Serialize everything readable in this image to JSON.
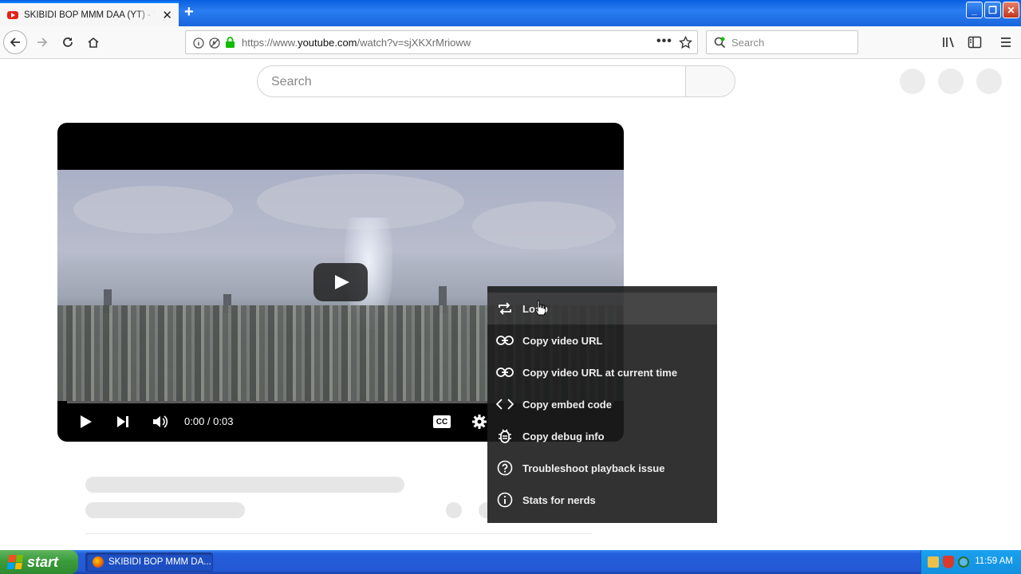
{
  "browser": {
    "tab_title": "SKIBIDI BOP MMM DAA (YT) - YouTube",
    "url_prefix": "https://www.",
    "url_domain": "youtube.com",
    "url_path": "/watch?v=sjXKXrMrioww",
    "search_placeholder": "Search"
  },
  "youtube": {
    "search_placeholder": "Search",
    "time": "0:00 / 0:03",
    "cc_label": "CC"
  },
  "context_menu": {
    "items": [
      {
        "label": "Loop",
        "icon": "loop-icon"
      },
      {
        "label": "Copy video URL",
        "icon": "link-icon"
      },
      {
        "label": "Copy video URL at current time",
        "icon": "link-icon"
      },
      {
        "label": "Copy embed code",
        "icon": "code-icon"
      },
      {
        "label": "Copy debug info",
        "icon": "bug-icon"
      },
      {
        "label": "Troubleshoot playback issue",
        "icon": "question-icon"
      },
      {
        "label": "Stats for nerds",
        "icon": "info-icon"
      }
    ]
  },
  "taskbar": {
    "start_label": "start",
    "task_label": "SKIBIDI BOP MMM DA...",
    "clock": "11:59 AM"
  }
}
